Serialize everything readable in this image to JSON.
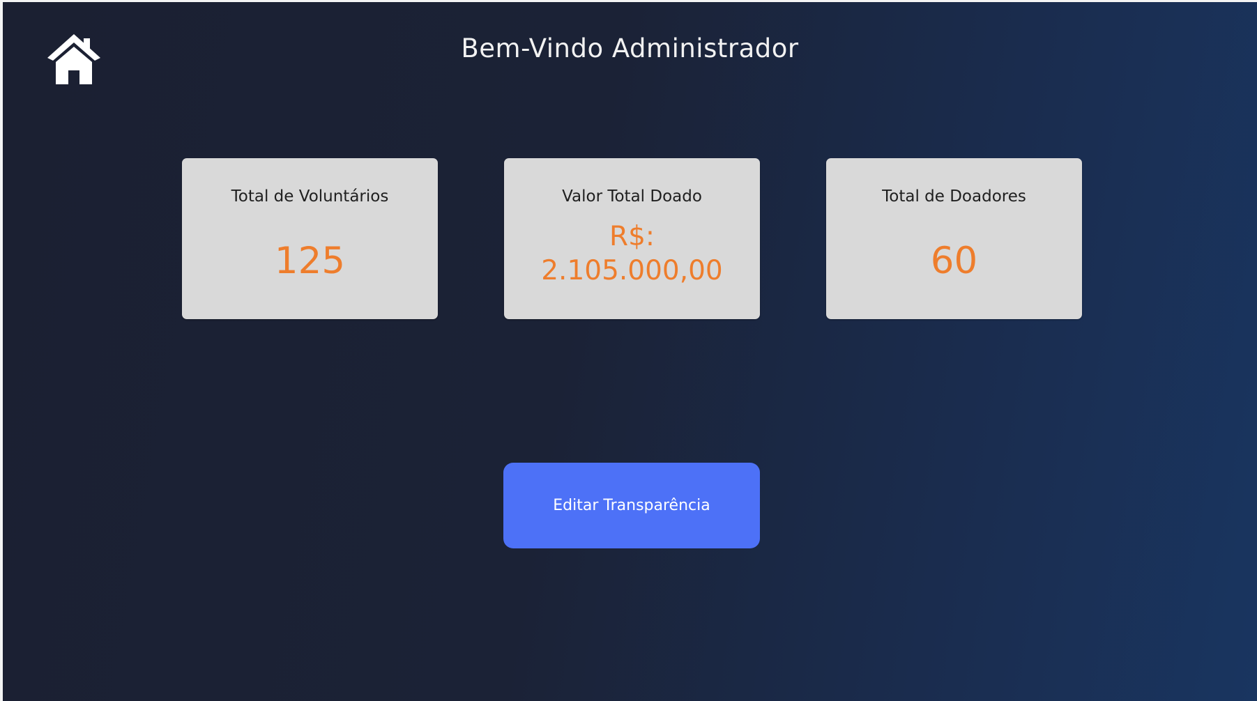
{
  "header": {
    "title": "Bem-Vindo Administrador",
    "home_icon": "home-icon"
  },
  "cards": [
    {
      "label": "Total de Voluntários",
      "value": "125"
    },
    {
      "label": "Valor Total Doado",
      "currency": "R$:",
      "value": "2.105.000,00"
    },
    {
      "label": "Total de Doadores",
      "value": "60"
    }
  ],
  "actions": {
    "edit_label": "Editar Transparência"
  },
  "colors": {
    "background_start": "#1b2032",
    "background_end": "#193560",
    "card_bg": "#d9d9d9",
    "value_accent": "#ee7d2c",
    "button_bg": "#4d71f7"
  }
}
